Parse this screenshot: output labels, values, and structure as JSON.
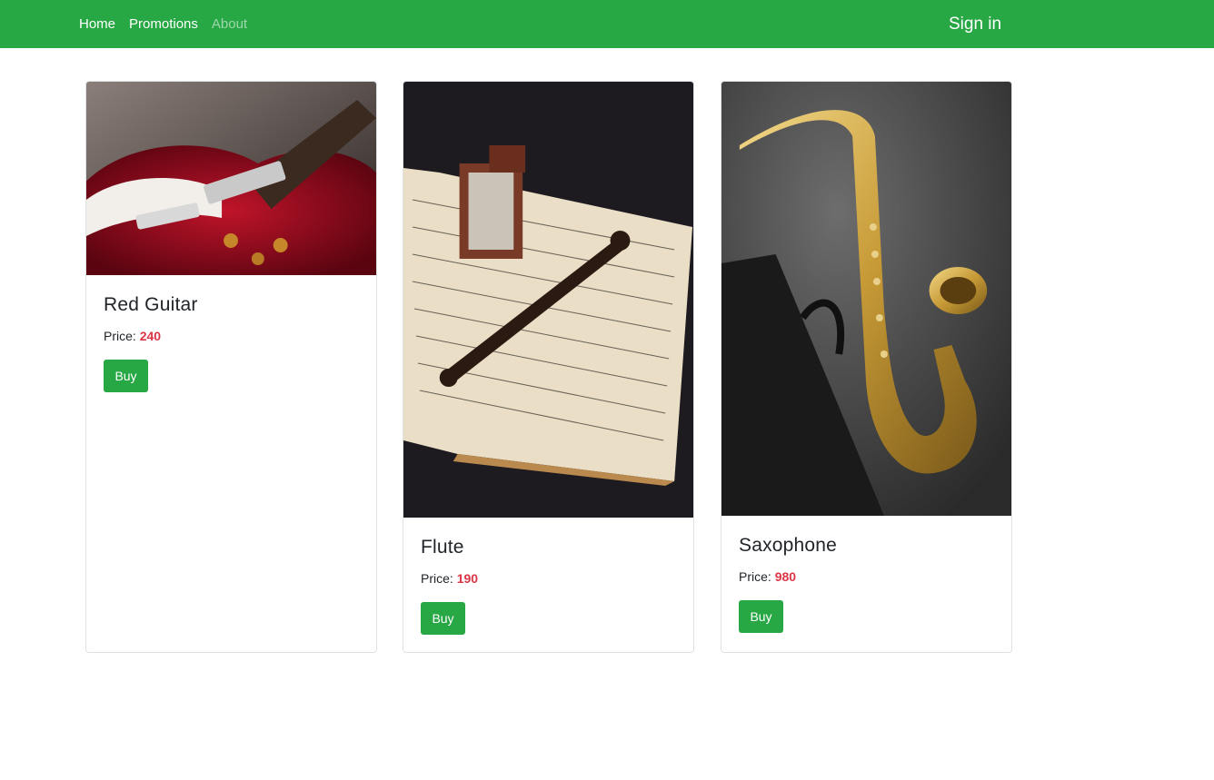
{
  "nav": {
    "links": [
      {
        "label": "Home"
      },
      {
        "label": "Promotions"
      },
      {
        "label": "About"
      }
    ],
    "sign_in_label": "Sign in"
  },
  "products": [
    {
      "name": "Red Guitar",
      "price_label": "Price:",
      "price": "240",
      "buy_label": "Buy",
      "image_icon": "guitar-photo"
    },
    {
      "name": "Flute",
      "price_label": "Price:",
      "price": "190",
      "buy_label": "Buy",
      "image_icon": "flute-photo"
    },
    {
      "name": "Saxophone",
      "price_label": "Price:",
      "price": "980",
      "buy_label": "Buy",
      "image_icon": "saxophone-photo"
    }
  ],
  "colors": {
    "brand_green": "#28a745",
    "price_red": "#dc3545"
  }
}
